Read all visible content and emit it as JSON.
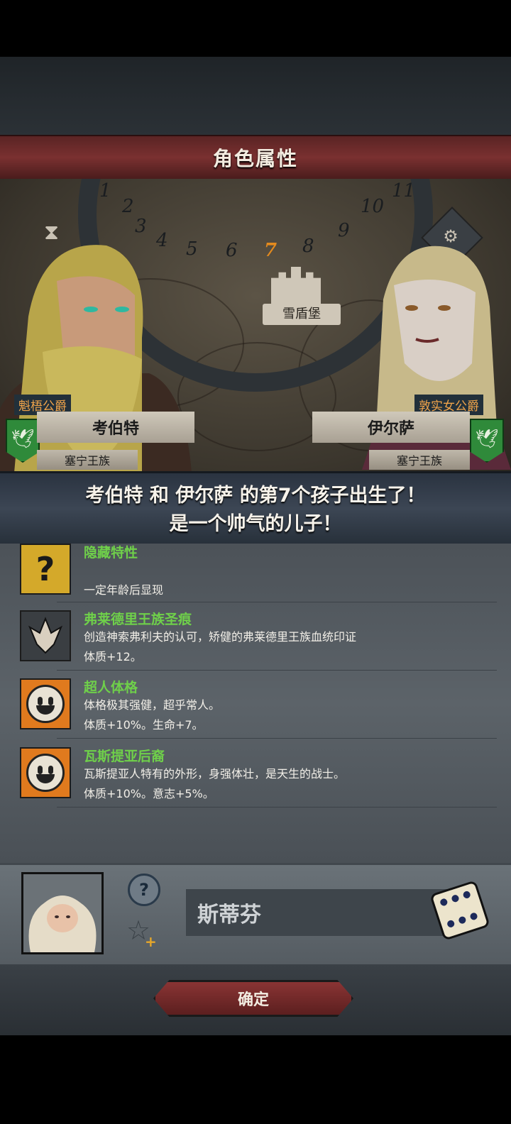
{
  "header": {
    "title": "角色属性"
  },
  "map": {
    "wheel_numbers": [
      "1",
      "2",
      "3",
      "4",
      "5",
      "6",
      "7",
      "8",
      "9",
      "10",
      "11"
    ],
    "active_number": "7",
    "location_name": "雪盾堡"
  },
  "father": {
    "title": "魁梧公爵",
    "name": "考伯特",
    "clan": "塞宁王族"
  },
  "mother": {
    "title": "敦实女公爵",
    "name": "伊尔萨",
    "clan": "塞宁王族"
  },
  "announcement": {
    "line1": "考伯特 和 伊尔萨 的第7个孩子出生了！",
    "line2": "是一个帅气的儿子！"
  },
  "traits": [
    {
      "name": "隐藏特性",
      "desc1": "",
      "desc2": "一定年龄后显现",
      "icon": "question-icon"
    },
    {
      "name": "弗莱德里王族圣痕",
      "desc1": "创造神索弗利夫的认可，矫健的弗莱德里王族血统印证",
      "desc2": "体质+12。",
      "icon": "stigmata-icon"
    },
    {
      "name": "超人体格",
      "desc1": "体格极其强健，超乎常人。",
      "desc2": "体质+10%。生命+7。",
      "icon": "smile-icon"
    },
    {
      "name": "瓦斯提亚后裔",
      "desc1": "瓦斯提亚人特有的外形，身强体壮，是天生的战士。",
      "desc2": "体质+10%。意志+5%。",
      "icon": "smile-icon"
    }
  ],
  "child": {
    "name_value": "斯蒂芬",
    "help_label": "?"
  },
  "footer": {
    "confirm_label": "确定"
  },
  "colors": {
    "title_bar": "#7a3030",
    "trait_name": "#6fd04a",
    "active_number": "#e38a1e"
  }
}
